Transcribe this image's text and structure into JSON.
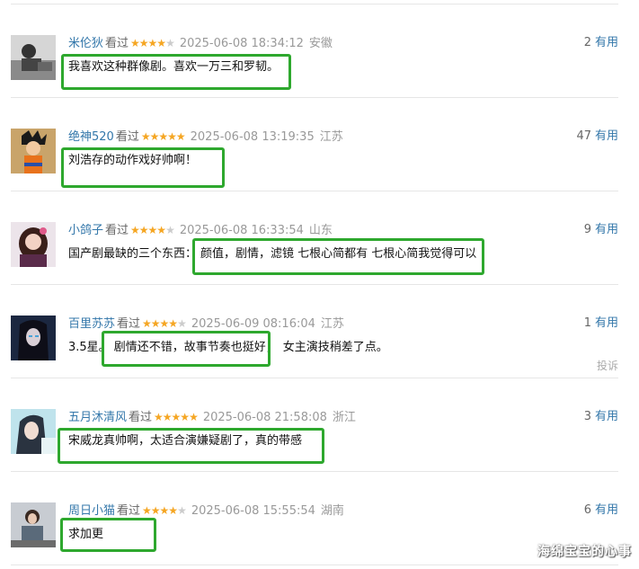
{
  "seen_label": "看过",
  "useful_label": "有用",
  "report_label": "投诉",
  "watermark": "海绵宝宝的心事",
  "comments": [
    {
      "user": "米伦狄",
      "rating": 4,
      "time": "2025-06-08 18:34:12",
      "location": "安徽",
      "useful": "2",
      "text_pre": "",
      "text_hl": "我喜欢这种群像剧。喜欢一万三和罗韧。",
      "text_post": ""
    },
    {
      "user": "绝神520",
      "rating": 5,
      "time": "2025-06-08 13:19:35",
      "location": "江苏",
      "useful": "47",
      "text_pre": "",
      "text_hl": "刘浩存的动作戏好帅啊！",
      "text_post": ""
    },
    {
      "user": "小鸽子",
      "rating": 4,
      "time": "2025-06-08 16:33:54",
      "location": "山东",
      "useful": "9",
      "text_pre": "国产剧最缺的三个东西：",
      "text_hl": "颜值，剧情，滤镜 七根心简都有 七根心简我觉得可以",
      "text_post": ""
    },
    {
      "user": "百里苏苏",
      "rating": 4,
      "time": "2025-06-09 08:16:04",
      "location": "江苏",
      "useful": "1",
      "text_pre": "3.5星。",
      "text_hl": "剧情还不错，故事节奏也挺好，",
      "text_post": "女主演技稍差了点。"
    },
    {
      "user": "五月沐清风",
      "rating": 5,
      "time": "2025-06-08 21:58:08",
      "location": "浙江",
      "useful": "3",
      "text_pre": "",
      "text_hl": "宋威龙真帅啊，太适合演嫌疑剧了，真的带感",
      "text_post": ""
    },
    {
      "user": "周日小猫",
      "rating": 4,
      "time": "2025-06-08 15:55:54",
      "location": "湖南",
      "useful": "6",
      "text_pre": "",
      "text_hl": "求加更",
      "text_post": ""
    }
  ]
}
